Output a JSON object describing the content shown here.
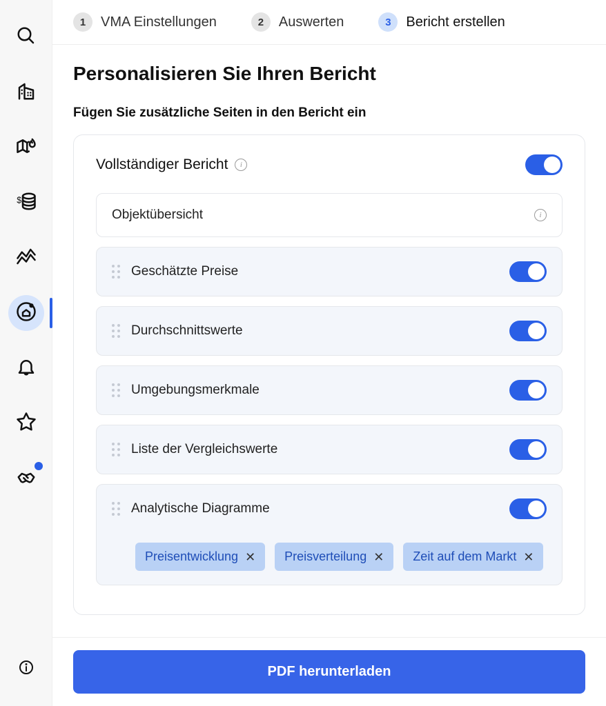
{
  "sidebar": {
    "items": [
      {
        "name": "search"
      },
      {
        "name": "building"
      },
      {
        "name": "map-fire"
      },
      {
        "name": "coins"
      },
      {
        "name": "trend"
      },
      {
        "name": "home-target",
        "active": true
      },
      {
        "name": "bell"
      },
      {
        "name": "star"
      },
      {
        "name": "handshake",
        "badge": true
      }
    ]
  },
  "steps": [
    {
      "num": "1",
      "label": "VMA Einstellungen"
    },
    {
      "num": "2",
      "label": "Auswerten"
    },
    {
      "num": "3",
      "label": "Bericht erstellen",
      "active": true
    }
  ],
  "page_title": "Personalisieren Sie Ihren Bericht",
  "subtitle": "Fügen Sie zusätzliche Seiten in den Bericht ein",
  "full_report_label": "Vollständiger Bericht",
  "sections": {
    "overview_label": "Objektübersicht",
    "items": [
      {
        "label": "Geschätzte Preise"
      },
      {
        "label": "Durchschnittswerte"
      },
      {
        "label": "Umgebungsmerkmale"
      },
      {
        "label": "Liste der Vergleichswerte"
      },
      {
        "label": "Analytische Diagramme",
        "chips": [
          "Preisentwicklung",
          "Preisverteilung",
          "Zeit auf dem Markt"
        ]
      }
    ]
  },
  "download_label": "PDF herunterladen"
}
